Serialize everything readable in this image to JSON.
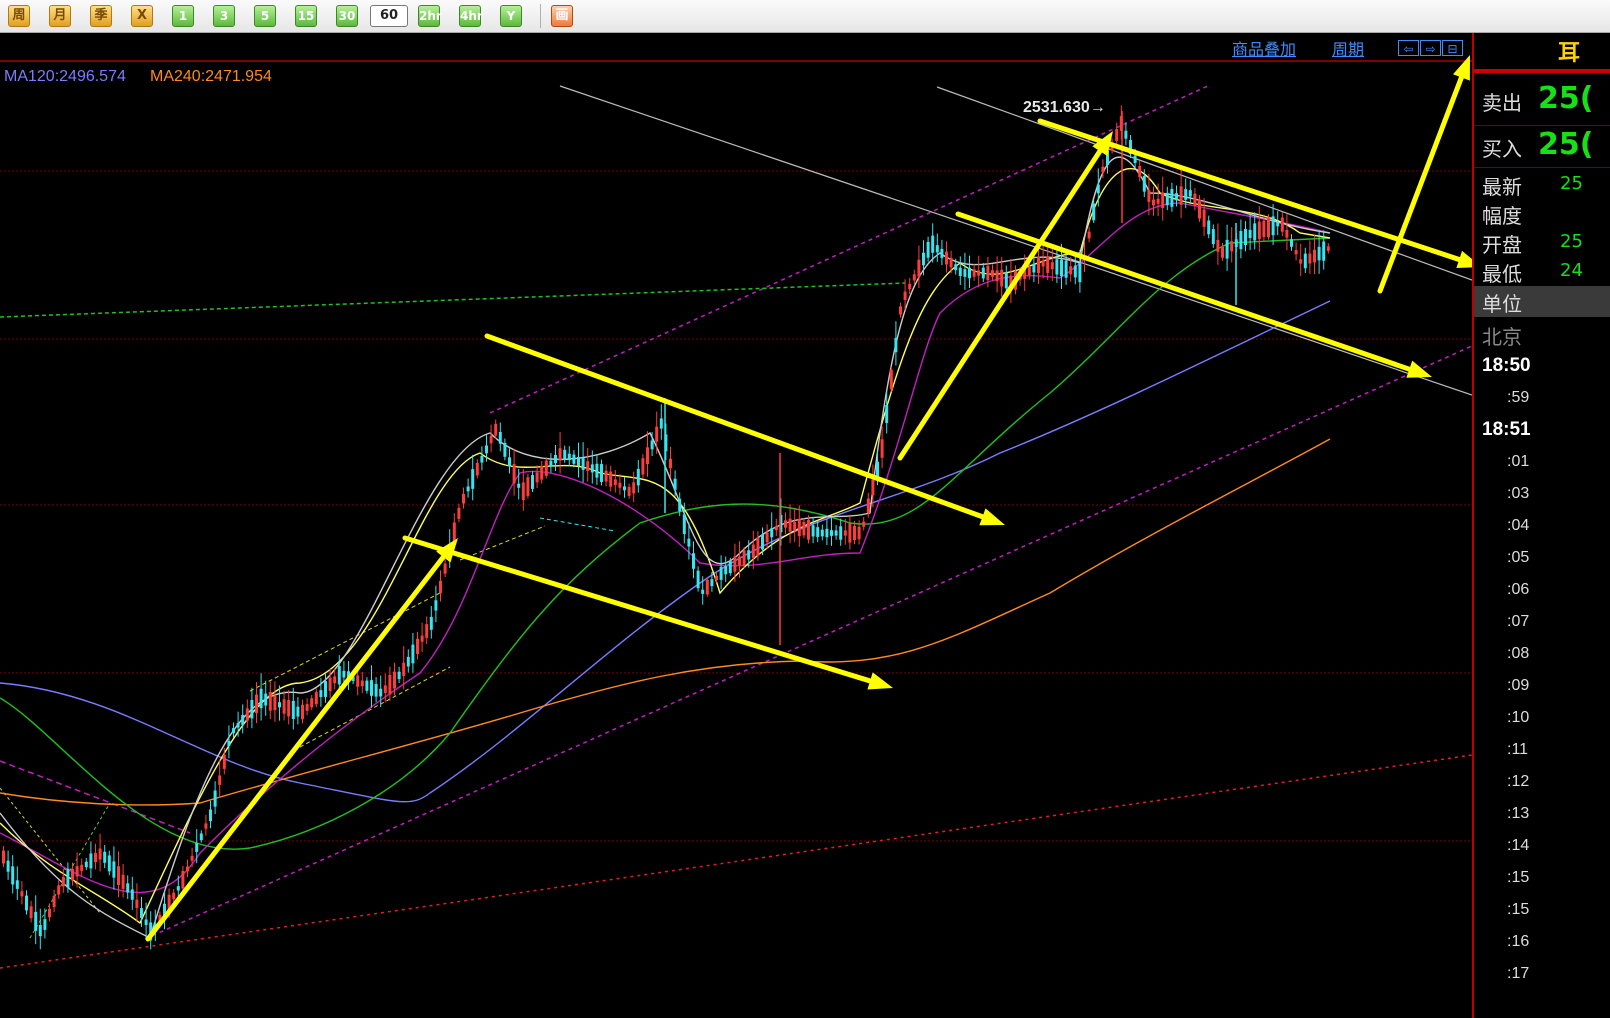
{
  "toolbar": {
    "buttons": [
      {
        "label": "周",
        "style": "o"
      },
      {
        "label": "月",
        "style": "o"
      },
      {
        "label": "季",
        "style": "o"
      },
      {
        "label": "X",
        "style": "o"
      },
      {
        "label": "1",
        "style": "g"
      },
      {
        "label": "3",
        "style": "g"
      },
      {
        "label": "5",
        "style": "g"
      },
      {
        "label": "15",
        "style": "g"
      },
      {
        "label": "30",
        "style": "g"
      },
      {
        "label": "60",
        "style": "active"
      },
      {
        "label": "2hr",
        "style": "g"
      },
      {
        "label": "4hr",
        "style": "g"
      },
      {
        "label": "Y",
        "style": "g"
      },
      {
        "label": "画",
        "style": "r"
      }
    ]
  },
  "header": {
    "overlay_link": "商品叠加",
    "period_link": "周期",
    "nav_buttons": [
      "⇦",
      "⇨",
      "⊟"
    ]
  },
  "indicators": {
    "ma120_label": "MA120:2496.574",
    "ma240_label": "MA240:2471.954",
    "ma120_color": "#7a7cff",
    "ma240_color": "#ff8a1e"
  },
  "chart": {
    "high_annotation": "2531.630→",
    "up_color": "#ff3b3b",
    "down_color": "#35e6f0",
    "arrow_color": "#ffff00",
    "dotted_channel_color": "#c020c0"
  },
  "quote_panel": {
    "sell_label": "卖出",
    "sell_value": "25(",
    "buy_label": "买入",
    "buy_value": "25(",
    "latest_label": "最新",
    "latest_value": "25",
    "range_label": "幅度",
    "open_label": "开盘",
    "open_value": "25",
    "low_label": "最低",
    "low_value": "24",
    "unit_label": "单位",
    "city_label": "北京",
    "corner_glyph": "耳"
  },
  "times": [
    "18:50",
    ":59",
    "18:51",
    ":01",
    ":03",
    ":04",
    ":05",
    ":06",
    ":07",
    ":08",
    ":09",
    ":10",
    ":11",
    ":12",
    ":13",
    ":14",
    ":15",
    ":15",
    ":16",
    ":17"
  ]
}
